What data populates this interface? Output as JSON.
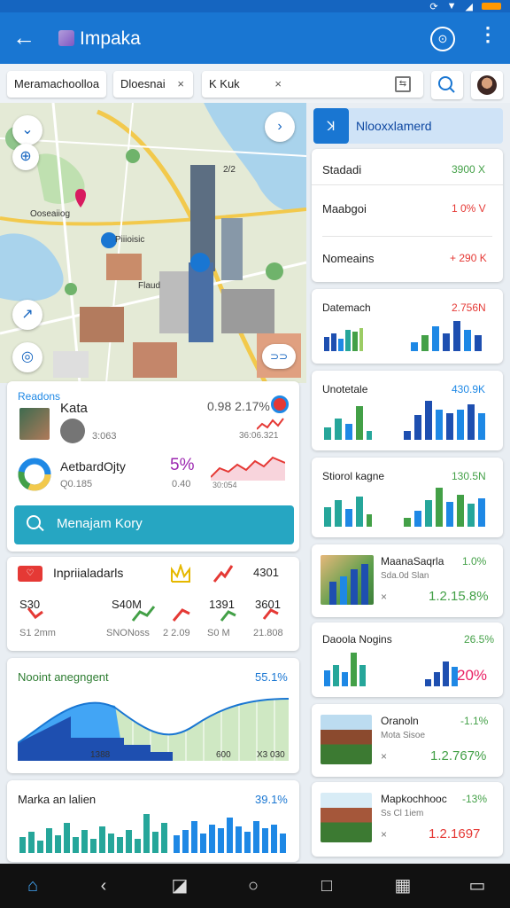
{
  "app": {
    "title": "Impaka"
  },
  "filters": {
    "chip1": "Meramachoolloa",
    "chip2": "Dloesnai",
    "chip3": "K Kuk",
    "close": "×"
  },
  "map": {
    "labels": [
      "Ooseaiiog",
      "Piiioisic",
      "Flaud"
    ],
    "pin_badge": "2/2"
  },
  "summary_card": {
    "heading": "Readons",
    "row1": {
      "name": "Kata",
      "sub": "3:063",
      "value": "0.98 2.17%",
      "sub_value": "36:06.321"
    },
    "row2": {
      "name": "AetbardOjty",
      "sub": "Q0.185",
      "pct": "5%",
      "pct_sub": "0.40",
      "trend_label": "30:054"
    }
  },
  "search": {
    "label": "Menajam Kory"
  },
  "indicators": {
    "title": "Inpriialadarls",
    "top_value": "4301",
    "values": [
      "S30",
      "S40M",
      "1391",
      "3601"
    ],
    "subs": [
      "S1 2mm",
      "SNONoss",
      "2 2.09",
      "S0 M",
      "21.808"
    ]
  },
  "area_card": {
    "title": "Nooint anegngent",
    "value": "55.1%",
    "labels": [
      "1388",
      "600",
      "X3 030"
    ]
  },
  "bar_card": {
    "title": "Marka an lalien",
    "value": "39.1%"
  },
  "right_panel": {
    "header": "Nlooxxlamerd",
    "list": [
      {
        "name": "Stadadi",
        "value": "3900 X",
        "tone": "g"
      },
      {
        "name": "Maabgoi",
        "value": "1 0% V",
        "tone": "r"
      },
      {
        "name": "Nomeains",
        "value": "+ 290 K",
        "tone": "r"
      }
    ],
    "mini_cards": [
      {
        "title": "Datemach",
        "value": "2.756N"
      },
      {
        "title": "Unotetale",
        "value": "430.9K"
      },
      {
        "title": "Stiorol kagne",
        "value": "130.5N"
      }
    ],
    "thumb_cards": [
      {
        "title": "MaanaSaqrla",
        "pct": "1.0%",
        "sub": "Sda.0d Slan",
        "value": "1.2.15.8%"
      },
      {
        "title": "Daoola Nogins",
        "pct": "26.5%",
        "sub": "",
        "value": "20%"
      },
      {
        "title": "Oranoln",
        "pct": "-1.1%",
        "sub": "Mota Sisoe",
        "value": "1.2.767%"
      },
      {
        "title": "Mapkochhooc",
        "pct": "-13%",
        "sub": "Ss Cl 1iem",
        "value": "1.2.1697"
      }
    ]
  }
}
